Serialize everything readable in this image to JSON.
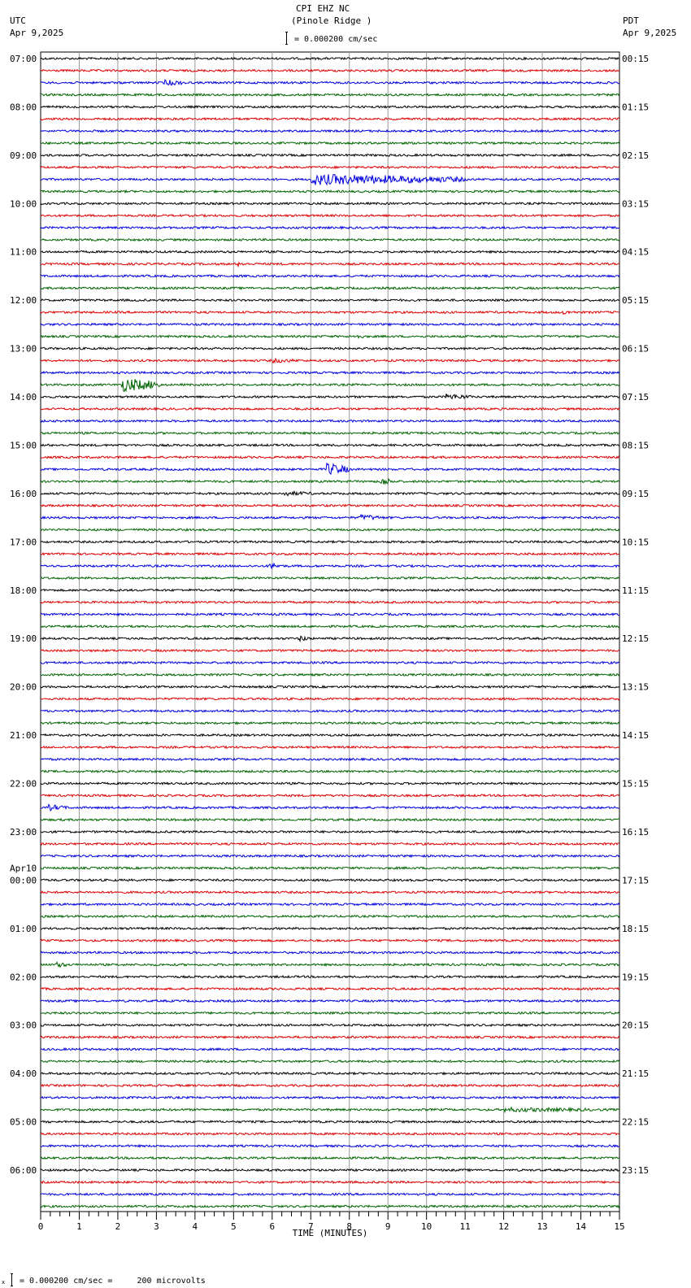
{
  "header": {
    "station": "CPI EHZ NC",
    "site": "(Pinole Ridge )",
    "left_tz": "UTC",
    "left_date": "Apr 9,2025",
    "right_tz": "PDT",
    "right_date": "Apr 9,2025",
    "scale_text": "= 0.000200 cm/sec"
  },
  "footer": {
    "scale_text": "= 0.000200 cm/sec =     200 microvolts",
    "corner_mark": "x"
  },
  "chart_data": {
    "type": "line",
    "title": "CPI EHZ NC (Pinole Ridge )",
    "xlabel": "TIME (MINUTES)",
    "xlim": [
      0,
      15
    ],
    "x_ticks": [
      "0",
      "1",
      "2",
      "3",
      "4",
      "5",
      "6",
      "7",
      "8",
      "9",
      "10",
      "11",
      "12",
      "13",
      "14",
      "15"
    ],
    "grid": true,
    "traces_per_hour": 4,
    "trace_colors": [
      "#000000",
      "#dd0000",
      "#0000dd",
      "#006400"
    ],
    "left_labels": [
      {
        "hour_index": 0,
        "text": "07:00"
      },
      {
        "hour_index": 1,
        "text": "08:00"
      },
      {
        "hour_index": 2,
        "text": "09:00"
      },
      {
        "hour_index": 3,
        "text": "10:00"
      },
      {
        "hour_index": 4,
        "text": "11:00"
      },
      {
        "hour_index": 5,
        "text": "12:00"
      },
      {
        "hour_index": 6,
        "text": "13:00"
      },
      {
        "hour_index": 7,
        "text": "14:00"
      },
      {
        "hour_index": 8,
        "text": "15:00"
      },
      {
        "hour_index": 9,
        "text": "16:00"
      },
      {
        "hour_index": 10,
        "text": "17:00"
      },
      {
        "hour_index": 11,
        "text": "18:00"
      },
      {
        "hour_index": 12,
        "text": "19:00"
      },
      {
        "hour_index": 13,
        "text": "20:00"
      },
      {
        "hour_index": 14,
        "text": "21:00"
      },
      {
        "hour_index": 15,
        "text": "22:00"
      },
      {
        "hour_index": 16,
        "text": "23:00"
      },
      {
        "hour_index": 17,
        "text": "00:00",
        "date": "Apr10"
      },
      {
        "hour_index": 18,
        "text": "01:00"
      },
      {
        "hour_index": 19,
        "text": "02:00"
      },
      {
        "hour_index": 20,
        "text": "03:00"
      },
      {
        "hour_index": 21,
        "text": "04:00"
      },
      {
        "hour_index": 22,
        "text": "05:00"
      },
      {
        "hour_index": 23,
        "text": "06:00"
      }
    ],
    "right_labels": [
      "00:15",
      "01:15",
      "02:15",
      "03:15",
      "04:15",
      "05:15",
      "06:15",
      "07:15",
      "08:15",
      "09:15",
      "10:15",
      "11:15",
      "12:15",
      "13:15",
      "14:15",
      "15:15",
      "16:15",
      "17:15",
      "18:15",
      "19:15",
      "20:15",
      "21:15",
      "22:15",
      "23:15"
    ],
    "events": [
      {
        "trace": 2,
        "minute": 3.2,
        "amplitude": 4,
        "duration": 0.6
      },
      {
        "trace": 10,
        "minute": 7.0,
        "amplitude": 7,
        "duration": 4.0
      },
      {
        "trace": 17,
        "minute": 5.1,
        "amplitude": 3,
        "duration": 0.3
      },
      {
        "trace": 21,
        "minute": 13.5,
        "amplitude": 3,
        "duration": 0.4
      },
      {
        "trace": 23,
        "minute": 8.1,
        "amplitude": 3,
        "duration": 0.4
      },
      {
        "trace": 25,
        "minute": 6.0,
        "amplitude": 3,
        "duration": 0.8
      },
      {
        "trace": 27,
        "minute": 2.1,
        "amplitude": 9,
        "duration": 1.0
      },
      {
        "trace": 28,
        "minute": 10.5,
        "amplitude": 4,
        "duration": 0.7
      },
      {
        "trace": 34,
        "minute": 7.4,
        "amplitude": 8,
        "duration": 0.6
      },
      {
        "trace": 35,
        "minute": 8.8,
        "amplitude": 5,
        "duration": 0.4
      },
      {
        "trace": 36,
        "minute": 6.3,
        "amplitude": 3,
        "duration": 1.0
      },
      {
        "trace": 38,
        "minute": 8.3,
        "amplitude": 4,
        "duration": 0.6
      },
      {
        "trace": 42,
        "minute": 5.9,
        "amplitude": 4,
        "duration": 0.4
      },
      {
        "trace": 48,
        "minute": 6.7,
        "amplitude": 4,
        "duration": 0.3
      },
      {
        "trace": 62,
        "minute": 0.2,
        "amplitude": 4,
        "duration": 0.5
      },
      {
        "trace": 75,
        "minute": 0.4,
        "amplitude": 4,
        "duration": 0.3
      },
      {
        "trace": 87,
        "minute": 12.0,
        "amplitude": 3,
        "duration": 3.0
      }
    ]
  }
}
